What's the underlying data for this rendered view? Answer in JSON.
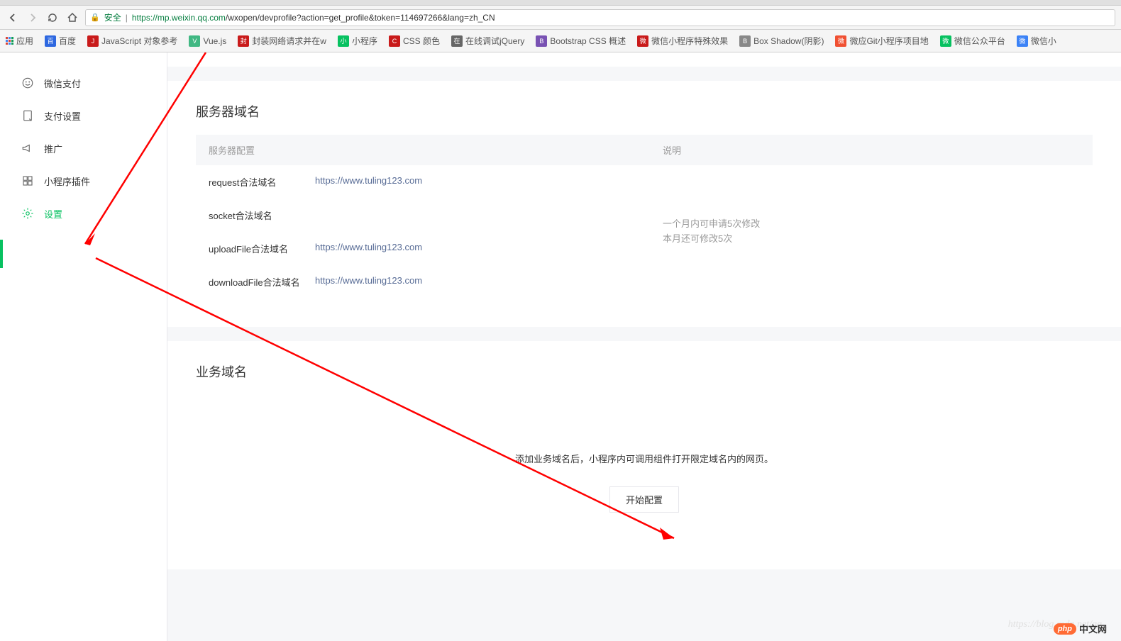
{
  "browser": {
    "secure_label": "安全",
    "url": "https://mp.weixin.qq.com/wxopen/devprofile?action=get_profile&token=114697266&lang=zh_CN",
    "url_host": "https://mp.weixin.qq.com",
    "url_path": "/wxopen/devprofile?action=get_profile&token=114697266&lang=zh_CN"
  },
  "bookmarks_bar": {
    "apps_label": "应用",
    "items": [
      {
        "label": "百度",
        "color": "#2e68e0"
      },
      {
        "label": "JavaScript 对象参考",
        "color": "#c91b1b"
      },
      {
        "label": "Vue.js",
        "color": "#41b883"
      },
      {
        "label": "封装网络请求并在w",
        "color": "#c91b1b"
      },
      {
        "label": "小程序",
        "color": "#07c160"
      },
      {
        "label": "CSS 颜色",
        "color": "#c91b1b"
      },
      {
        "label": "在线调试jQuery",
        "color": "#666"
      },
      {
        "label": "Bootstrap CSS 概述",
        "color": "#7952b3"
      },
      {
        "label": "微信小程序特殊效果",
        "color": "#c91b1b"
      },
      {
        "label": "Box Shadow(阴影)",
        "color": "#888"
      },
      {
        "label": "微应Git小程序项目地",
        "color": "#f05032"
      },
      {
        "label": "微信公众平台",
        "color": "#07c160"
      },
      {
        "label": "微信小",
        "color": "#3b82f6"
      }
    ]
  },
  "sidebar": {
    "items": [
      {
        "label": "微信支付",
        "icon": "smile"
      },
      {
        "label": "支付设置",
        "icon": "page"
      },
      {
        "label": "推广",
        "icon": "megaphone"
      },
      {
        "label": "小程序插件",
        "icon": "grid"
      },
      {
        "label": "设置",
        "icon": "gear",
        "active": true
      }
    ]
  },
  "section_server": {
    "title": "服务器域名",
    "col_config": "服务器配置",
    "col_desc": "说明",
    "rows": [
      {
        "label": "request合法域名",
        "value": "https://www.tuling123.com"
      },
      {
        "label": "socket合法域名",
        "value": ""
      },
      {
        "label": "uploadFile合法域名",
        "value": "https://www.tuling123.com"
      },
      {
        "label": "downloadFile合法域名",
        "value": "https://www.tuling123.com"
      }
    ],
    "desc_line1": "一个月内可申请5次修改",
    "desc_line2": "本月还可修改5次"
  },
  "section_biz": {
    "title": "业务域名",
    "desc": "添加业务域名后，小程序内可调用组件打开限定域名内的网页。",
    "button": "开始配置"
  },
  "watermark": {
    "url": "https://blog.csdn.net/qq_",
    "badge": "php",
    "text": "中文网"
  }
}
